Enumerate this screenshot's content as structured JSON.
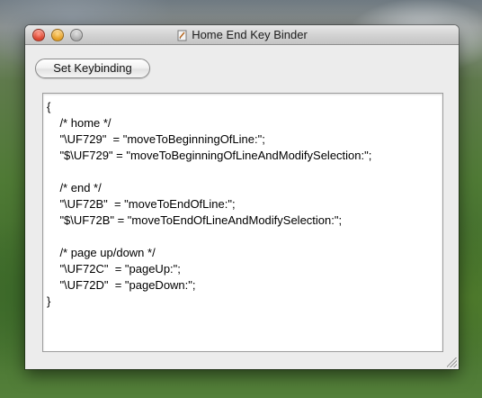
{
  "window": {
    "title": "Home End Key Binder"
  },
  "toolbar": {
    "set_keybinding_label": "Set Keybinding"
  },
  "editor": {
    "content": "{\n    /* home */\n    \"\\UF729\"  = \"moveToBeginningOfLine:\";\n    \"$\\UF729\" = \"moveToBeginningOfLineAndModifySelection:\";\n\n    /* end */\n    \"\\UF72B\"  = \"moveToEndOfLine:\";\n    \"$\\UF72B\" = \"moveToEndOfLineAndModifySelection:\";\n\n    /* page up/down */\n    \"\\UF72C\"  = \"pageUp:\";\n    \"\\UF72D\"  = \"pageDown:\";\n}"
  },
  "icons": {
    "close": "close-button",
    "minimize": "minimize-button",
    "zoom": "zoom-button",
    "app": "script-document-icon",
    "grip": "resize-grip-icon"
  }
}
